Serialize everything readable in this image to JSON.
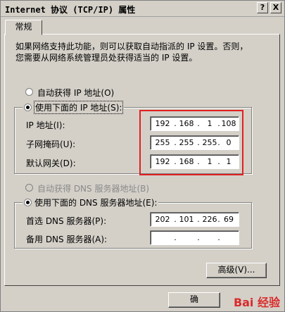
{
  "window": {
    "title": "Internet 协议 (TCP/IP) 属性",
    "help_btn": "?",
    "close_btn": "X"
  },
  "tabs": [
    {
      "label": "常规"
    }
  ],
  "description": [
    "如果网络支持此功能，则可以获取自动指派的 IP 设置。否则，",
    "您需要从网络系统管理员处获得适当的 IP 设置。"
  ],
  "ip": {
    "auto_label": "自动获得 IP 地址(O)",
    "manual_label": "使用下面的 IP 地址(S):",
    "selected": "manual",
    "fields": [
      {
        "label": "IP 地址(I):",
        "octets": [
          "192",
          "168",
          "1",
          "108"
        ]
      },
      {
        "label": "子网掩码(U):",
        "octets": [
          "255",
          "255",
          "255",
          "0"
        ]
      },
      {
        "label": "默认网关(D):",
        "octets": [
          "192",
          "168",
          "1",
          "1"
        ]
      }
    ]
  },
  "dns": {
    "auto_label": "自动获得 DNS 服务器地址(B)",
    "manual_label": "使用下面的 DNS 服务器地址(E):",
    "selected": "manual",
    "fields": [
      {
        "label": "首选 DNS 服务器(P):",
        "octets": [
          "202",
          "101",
          "226",
          "69"
        ]
      },
      {
        "label": "备用 DNS 服务器(A):",
        "octets": [
          "",
          "",
          "",
          ""
        ]
      }
    ]
  },
  "buttons": {
    "advanced": "高级(V)...",
    "ok": "确"
  },
  "watermark": {
    "text": "Bai 经验",
    "colors": [
      "#d92b2b",
      "#2a62c9",
      "#f0a01a"
    ]
  },
  "highlight_color": "#e02020"
}
